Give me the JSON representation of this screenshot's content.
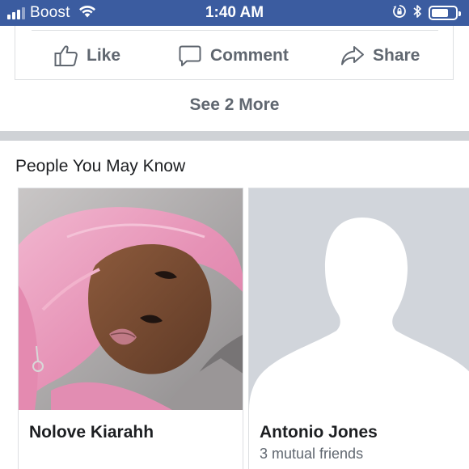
{
  "status_bar": {
    "carrier": "Boost",
    "time": "1:40 AM",
    "signal_bars": 4,
    "signal_bars_active": 3,
    "wifi_icon": "wifi-icon",
    "orientation_lock_icon": "orientation-lock-icon",
    "bluetooth_icon": "bluetooth-icon",
    "battery_icon": "battery-icon",
    "battery_level_fraction": 0.7
  },
  "post_actions": {
    "like_label": "Like",
    "comment_label": "Comment",
    "share_label": "Share",
    "like_icon": "thumbs-up-icon",
    "comment_icon": "speech-bubble-icon",
    "share_icon": "share-arrow-icon"
  },
  "comments": {
    "see_more_label": "See 2 More"
  },
  "people_you_may_know": {
    "heading": "People You May Know",
    "people": [
      {
        "name": "Nolove Kiarahh",
        "mutual_friends": "",
        "photo": "profile-photo"
      },
      {
        "name": "Antonio Jones",
        "mutual_friends": "3 mutual friends",
        "photo": "default-avatar-silhouette"
      }
    ]
  },
  "colors": {
    "status_bar_bg": "#3b5ca0",
    "action_text": "#606770",
    "primary_text": "#1c1e21",
    "border": "#dddfe2",
    "section_separator": "#cfd2d6",
    "placeholder_bg": "#d1d5db"
  }
}
